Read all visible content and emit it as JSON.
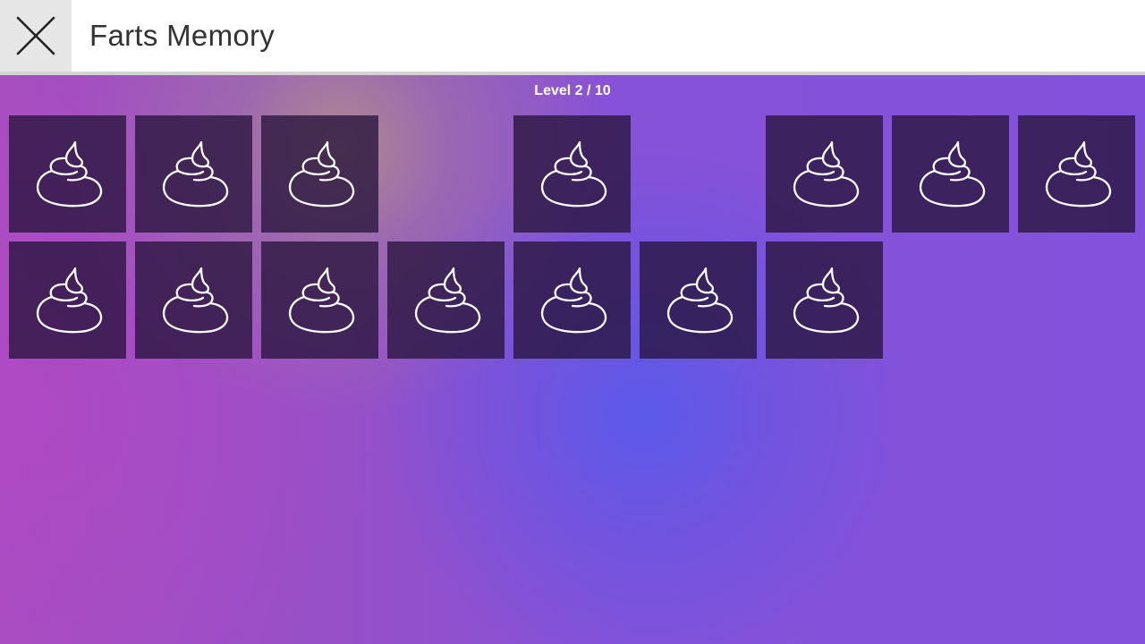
{
  "header": {
    "title": "Farts Memory",
    "close_icon": "close-icon"
  },
  "game": {
    "level_label": "Level 2 / 10",
    "card_back_icon": "poop-icon",
    "cards": [
      {
        "state": "hidden"
      },
      {
        "state": "hidden"
      },
      {
        "state": "hidden"
      },
      {
        "state": "matched"
      },
      {
        "state": "hidden"
      },
      {
        "state": "matched"
      },
      {
        "state": "hidden"
      },
      {
        "state": "hidden"
      },
      {
        "state": "hidden"
      },
      {
        "state": "hidden"
      },
      {
        "state": "hidden"
      },
      {
        "state": "hidden"
      },
      {
        "state": "hidden"
      },
      {
        "state": "hidden"
      },
      {
        "state": "hidden"
      },
      {
        "state": "hidden"
      }
    ]
  },
  "colors": {
    "header_bg": "#ffffff",
    "close_bg": "#e6e6e6",
    "game_bg": "#8252dc",
    "card_bg": "#2d1a40",
    "icon_stroke": "#ffffff"
  }
}
